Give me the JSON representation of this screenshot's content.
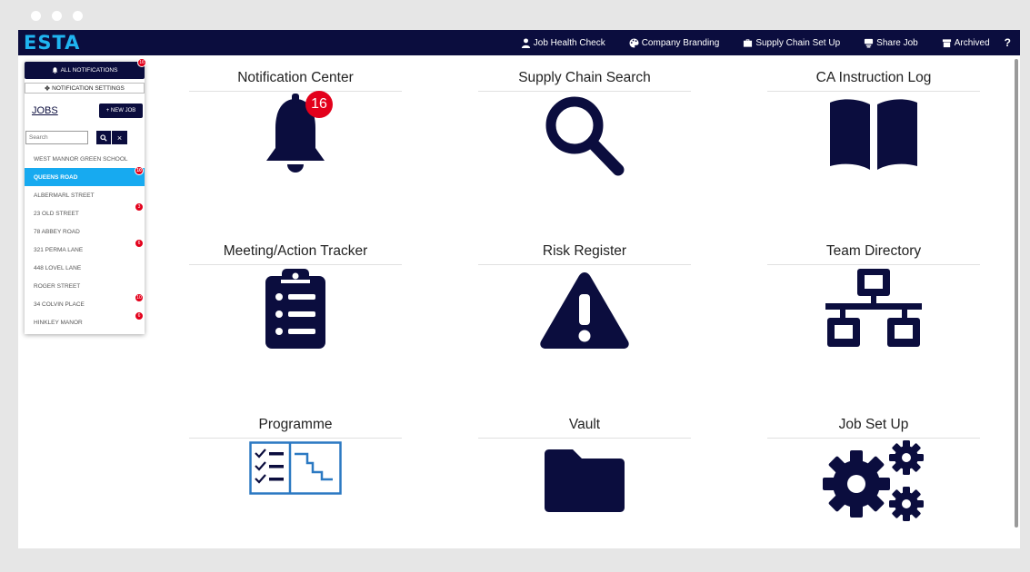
{
  "app": {
    "logo": "ESTA"
  },
  "topnav": [
    {
      "label": "Job Health Check",
      "icon": "user-icon"
    },
    {
      "label": "Company Branding",
      "icon": "palette-icon"
    },
    {
      "label": "Supply Chain Set Up",
      "icon": "briefcase-icon"
    },
    {
      "label": "Share Job",
      "icon": "share-icon"
    },
    {
      "label": "Archived",
      "icon": "archive-icon"
    }
  ],
  "help_label": "?",
  "sidebar": {
    "all_notifications_label": "ALL NOTIFICATIONS",
    "all_notifications_count": "16",
    "notification_settings_label": "NOTIFICATION SETTINGS",
    "jobs_label": "JOBS",
    "new_job_label": "+ NEW JOB",
    "search_placeholder": "Search",
    "clear_label": "×",
    "jobs": [
      {
        "name": "WEST MANNOR GREEN SCHOOL",
        "badge": ""
      },
      {
        "name": "QUEENS ROAD",
        "badge": "10",
        "active": true
      },
      {
        "name": "ALBERMARL STREET",
        "badge": ""
      },
      {
        "name": "23 OLD STREET",
        "badge": "3"
      },
      {
        "name": "78 ABBEY ROAD",
        "badge": ""
      },
      {
        "name": "321 PERMA LANE",
        "badge": "6"
      },
      {
        "name": "448 LOVEL LANE",
        "badge": ""
      },
      {
        "name": "ROGER STREET",
        "badge": ""
      },
      {
        "name": "34 COLVIN PLACE",
        "badge": "10"
      },
      {
        "name": "HINKLEY MANOR",
        "badge": "6"
      }
    ]
  },
  "tiles": [
    {
      "title": "Notification Center",
      "icon": "bell-icon",
      "badge": "16"
    },
    {
      "title": "Supply Chain Search",
      "icon": "magnifier-icon"
    },
    {
      "title": "CA Instruction Log",
      "icon": "book-icon"
    },
    {
      "title": "Meeting/Action Tracker",
      "icon": "clipboard-list-icon"
    },
    {
      "title": "Risk Register",
      "icon": "warning-icon"
    },
    {
      "title": "Team Directory",
      "icon": "network-icon"
    },
    {
      "title": "Programme",
      "icon": "gantt-checklist-icon"
    },
    {
      "title": "Vault",
      "icon": "folder-icon"
    },
    {
      "title": "Job Set Up",
      "icon": "gears-icon"
    }
  ],
  "colors": {
    "navy": "#0b0d3e",
    "accent": "#17aaf0",
    "badge": "#e3001b",
    "programme_blue": "#2b79c2"
  }
}
